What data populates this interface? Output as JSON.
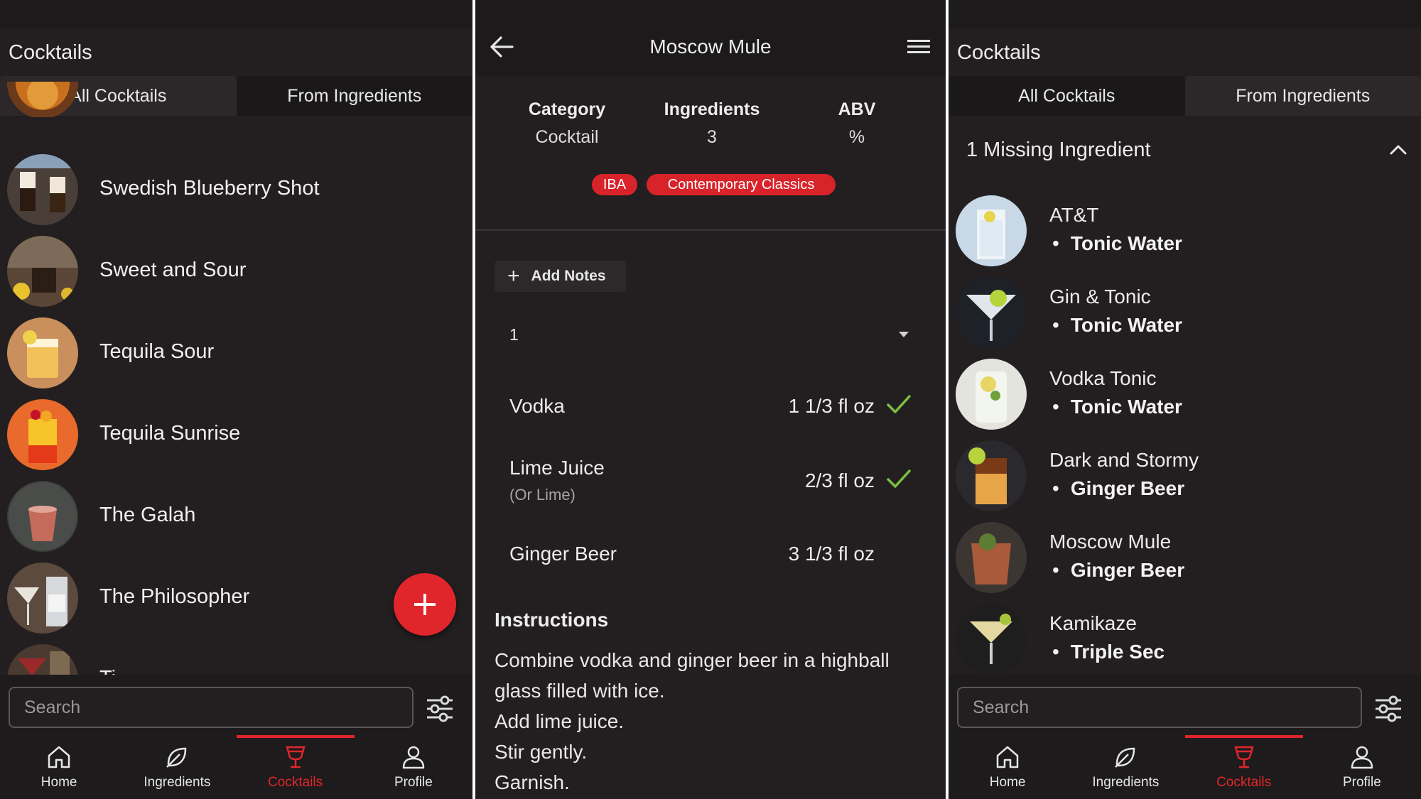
{
  "colors": {
    "accent": "#e0262b",
    "background": "#231f20",
    "check": "#7bc043"
  },
  "screen1": {
    "title": "Cocktails",
    "tabs": [
      "All Cocktails",
      "From Ingredients"
    ],
    "active_tab": 0,
    "items": [
      {
        "label": "Swedish Blueberry Shot"
      },
      {
        "label": "Sweet and Sour"
      },
      {
        "label": "Tequila Sour"
      },
      {
        "label": "Tequila Sunrise"
      },
      {
        "label": "The Galah"
      },
      {
        "label": "The Philosopher"
      },
      {
        "label": "Ti"
      }
    ],
    "fab_icon": "plus-icon",
    "search_placeholder": "Search",
    "nav": [
      "Home",
      "Ingredients",
      "Cocktails",
      "Profile"
    ],
    "active_nav": 2
  },
  "screen2": {
    "title": "Moscow Mule",
    "stats": [
      {
        "label": "Category",
        "value": "Cocktail"
      },
      {
        "label": "Ingredients",
        "value": "3"
      },
      {
        "label": "ABV",
        "value": "%"
      }
    ],
    "tags": [
      "IBA",
      "Contemporary Classics"
    ],
    "add_notes": "Add Notes",
    "servings": "1",
    "ingredients": [
      {
        "name": "Vodka",
        "sub": "",
        "amount": "1 1/3 fl oz",
        "available": true
      },
      {
        "name": "Lime Juice",
        "sub": "(Or Lime)",
        "amount": "2/3 fl oz",
        "available": true
      },
      {
        "name": "Ginger Beer",
        "sub": "",
        "amount": "3 1/3 fl oz",
        "available": false
      }
    ],
    "instructions_title": "Instructions",
    "instructions": [
      "Combine vodka and ginger beer in a highball",
      "glass filled with ice.",
      "Add lime juice.",
      "Stir gently.",
      "Garnish."
    ]
  },
  "screen3": {
    "title": "Cocktails",
    "tabs": [
      "All Cocktails",
      "From Ingredients"
    ],
    "active_tab": 1,
    "section": "1 Missing Ingredient",
    "items": [
      {
        "name": "AT&T",
        "missing": "Tonic Water"
      },
      {
        "name": "Gin & Tonic",
        "missing": "Tonic Water"
      },
      {
        "name": "Vodka Tonic",
        "missing": "Tonic Water"
      },
      {
        "name": "Dark and Stormy",
        "missing": "Ginger Beer"
      },
      {
        "name": "Moscow Mule",
        "missing": "Ginger Beer"
      },
      {
        "name": "Kamikaze",
        "missing": "Triple Sec"
      }
    ],
    "search_placeholder": "Search",
    "nav": [
      "Home",
      "Ingredients",
      "Cocktails",
      "Profile"
    ],
    "active_nav": 2
  }
}
